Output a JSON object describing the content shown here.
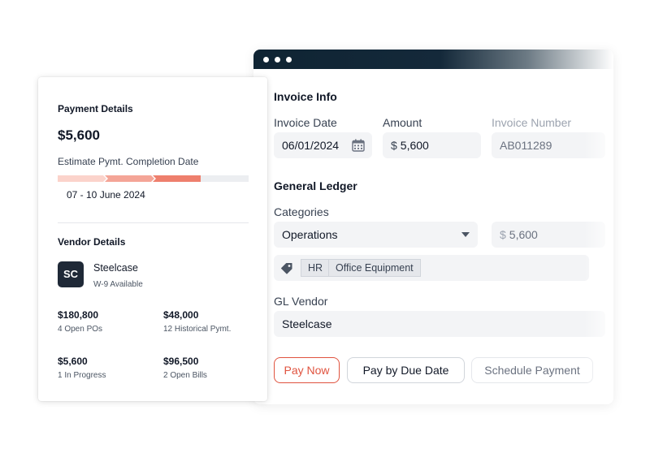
{
  "invoice_window": {
    "section_invoice_info": "Invoice Info",
    "invoice_date": {
      "label": "Invoice Date",
      "value": "06/01/2024"
    },
    "amount": {
      "label": "Amount",
      "currency": "$",
      "value": "5,600"
    },
    "invoice_number": {
      "label": "Invoice Number",
      "value": "AB011289"
    },
    "section_general_ledger": "General Ledger",
    "categories": {
      "label": "Categories",
      "selected": "Operations",
      "currency": "$",
      "amount": "5,600"
    },
    "tags": [
      "HR",
      "Office Equipment"
    ],
    "gl_vendor": {
      "label": "GL Vendor",
      "value": "Steelcase"
    },
    "buttons": {
      "pay_now": "Pay Now",
      "pay_by_due_date": "Pay by Due Date",
      "schedule_payment": "Schedule Payment"
    }
  },
  "payment_card": {
    "title": "Payment Details",
    "amount": "$5,600",
    "estimate_label": "Estimate Pymt. Completion Date",
    "date_range": "07 - 10 June 2024",
    "progress_steps_completed": 3,
    "progress_steps_total": 4,
    "vendor_title": "Vendor Details",
    "vendor": {
      "initials": "SC",
      "name": "Steelcase",
      "status": "W-9 Available"
    },
    "stats": [
      {
        "value": "$180,800",
        "label": "4 Open POs"
      },
      {
        "value": "$48,000",
        "label": "12 Historical Pymt."
      },
      {
        "value": "$5,600",
        "label": "1 In Progress"
      },
      {
        "value": "$96,500",
        "label": "2 Open Bills"
      }
    ]
  },
  "colors": {
    "accent": "#e0533f",
    "progress_light": "#fbd3cb",
    "progress_mid": "#f4a597",
    "progress_strong": "#ee7f6d",
    "titlebar": "#0f2433"
  },
  "icons": [
    "calendar-icon",
    "dropdown-caret-icon",
    "tag-icon"
  ]
}
